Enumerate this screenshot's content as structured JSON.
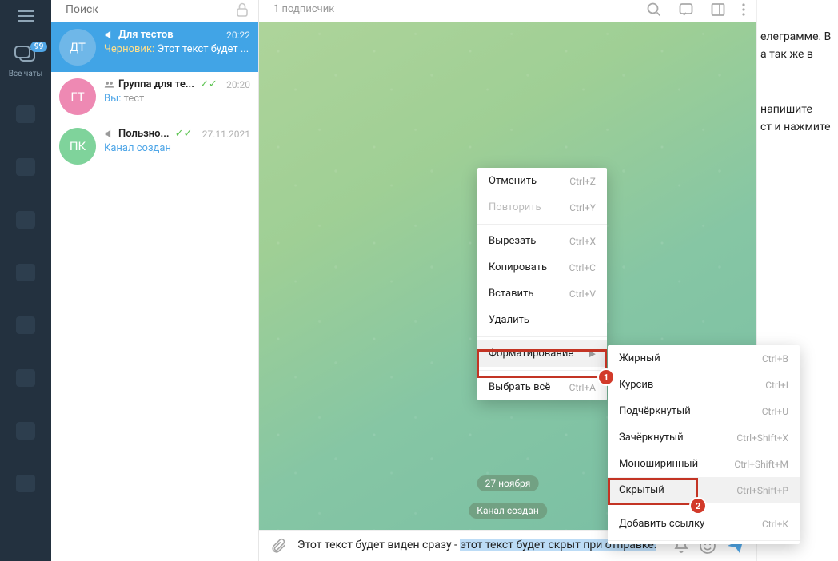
{
  "rail": {
    "badge": "99",
    "label": "Все чаты"
  },
  "search": {
    "placeholder": "Поиск"
  },
  "chats": [
    {
      "avatar": "ДТ",
      "name": "Для тестов",
      "time": "20:22",
      "draft_label": "Черновик:",
      "preview": "Этот текст будет ...",
      "active": true,
      "type": "channel"
    },
    {
      "avatar": "ГТ",
      "name": "Группа для те...",
      "time": "20:20",
      "you_label": "Вы:",
      "preview": "тест",
      "read": true,
      "type": "group"
    },
    {
      "avatar": "ПК",
      "name": "Пользно...",
      "time": "27.11.2021",
      "preview": "Канал создан",
      "read": true,
      "type": "channel"
    }
  ],
  "header": {
    "subscribers": "1 подписчик"
  },
  "chat": {
    "date_pill": "27 ноября",
    "service_pill": "Канал создан",
    "input_plain": "Этот текст будет виден сразу - ",
    "input_selected": "этот текст будет скрыт при отправке."
  },
  "right_text": {
    "p1a": "елеграмме. В",
    "p1b": "а так же в",
    "p2a": "напишите",
    "p2b": "ст и нажмите"
  },
  "ctx1": {
    "undo": "Отменить",
    "undo_sc": "Ctrl+Z",
    "redo": "Повторить",
    "redo_sc": "Ctrl+Y",
    "cut": "Вырезать",
    "cut_sc": "Ctrl+X",
    "copy": "Копировать",
    "copy_sc": "Ctrl+C",
    "paste": "Вставить",
    "paste_sc": "Ctrl+V",
    "delete": "Удалить",
    "format": "Форматирование",
    "select_all": "Выбрать всё",
    "select_all_sc": "Ctrl+A"
  },
  "ctx2": {
    "bold": "Жирный",
    "bold_sc": "Ctrl+B",
    "italic": "Курсив",
    "italic_sc": "Ctrl+I",
    "underline": "Подчёркнутый",
    "underline_sc": "Ctrl+U",
    "strike": "Зачёркнутый",
    "strike_sc": "Ctrl+Shift+X",
    "mono": "Моноширинный",
    "mono_sc": "Ctrl+Shift+M",
    "spoiler": "Скрытый",
    "spoiler_sc": "Ctrl+Shift+P",
    "link": "Добавить ссылку",
    "link_sc": "Ctrl+K"
  },
  "callouts": {
    "one": "1",
    "two": "2"
  }
}
